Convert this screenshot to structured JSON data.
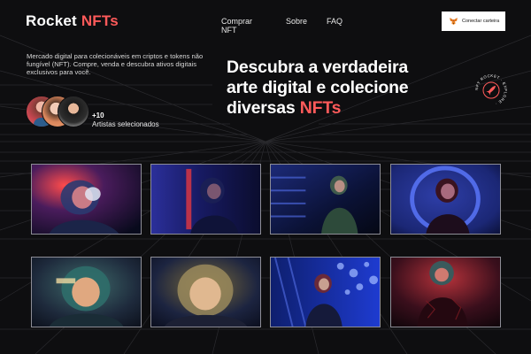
{
  "brand": {
    "name": "Rocket",
    "accent": "NFTs",
    "accent_color": "#ff5a5a"
  },
  "nav": {
    "items": [
      "Comprar NFT",
      "Sobre",
      "FAQ"
    ]
  },
  "wallet": {
    "label": "Conectar carteira",
    "icon": "metamask-fox-icon"
  },
  "intro": {
    "text": "Mercado digital para colecionáveis em criptos e tokens não fungível (NFT). Compre, venda e descubra ativos digitais exclusivos para você."
  },
  "artists": {
    "count": "+10",
    "label": "Artistas selecionados"
  },
  "hero": {
    "line1": "Descubra a verdadeira",
    "line2": "arte digital e colecione",
    "line3_prefix": "diversas ",
    "line3_accent": "NFTs"
  },
  "badge": {
    "icon": "rocket-icon",
    "text": "NFT ROCKET · EXPLORE ·"
  },
  "gallery": {
    "items": [
      {
        "name": "astronaut-helmet-red-glow",
        "icon": "astronaut-image"
      },
      {
        "name": "astronaut-blue-red-light",
        "icon": "astronaut-image"
      },
      {
        "name": "astronaut-stairs-green",
        "icon": "astronaut-image"
      },
      {
        "name": "astronaut-ring-blue",
        "icon": "astronaut-image"
      },
      {
        "name": "astronaut-green-helmet",
        "icon": "astronaut-image"
      },
      {
        "name": "astronaut-closeup-gold",
        "icon": "astronaut-image"
      },
      {
        "name": "astronaut-bokeh-blue",
        "icon": "astronaut-image"
      },
      {
        "name": "astronaut-red-shadow",
        "icon": "astronaut-image"
      }
    ]
  }
}
